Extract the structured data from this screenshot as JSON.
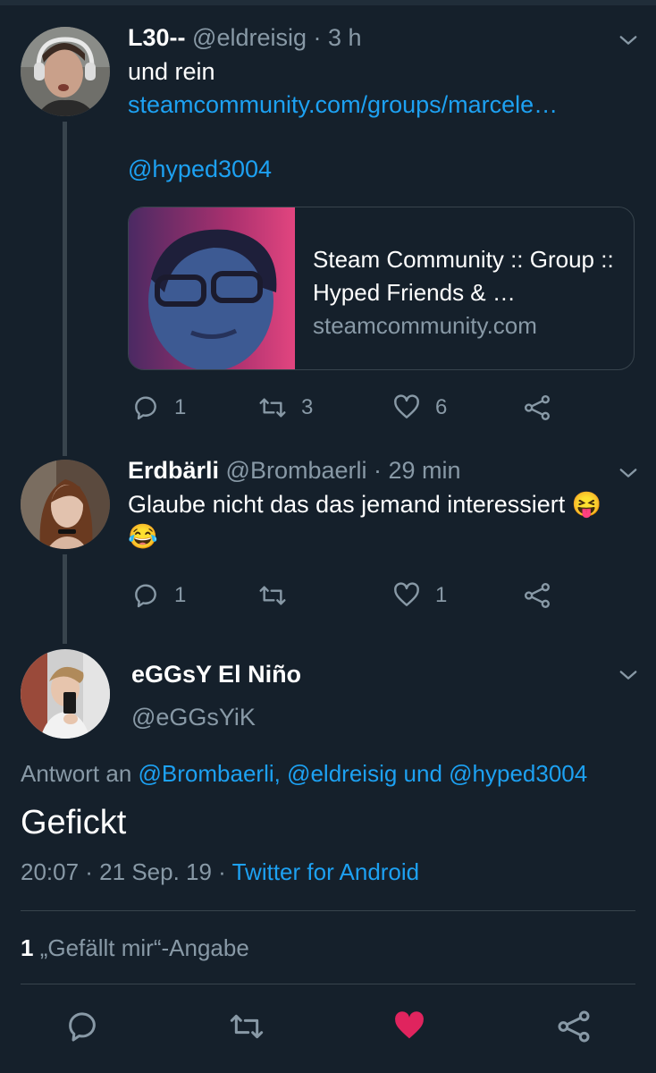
{
  "tweets": [
    {
      "name": "L30--",
      "handle": "@eldreisig",
      "time": "· 3 h",
      "text_line1": "und rein",
      "link": "steamcommunity.com/groups/marcele…",
      "mention": "@hyped3004",
      "card": {
        "title": "Steam Community :: Group :: Hyped Friends & …",
        "domain": "steamcommunity.com"
      },
      "replies": "1",
      "retweets": "3",
      "likes": "6"
    },
    {
      "name": "Erdbärli",
      "handle": "@Brombaerli",
      "time": "· 29 min",
      "text": "Glaube nicht das das jemand interessiert",
      "emoji_1": "😝",
      "emoji_2": "😂",
      "replies": "1",
      "retweets": "",
      "likes": "1"
    }
  ],
  "focused": {
    "name": "eGGsY El Niño",
    "handle": "@eGGsYiK",
    "reply_prefix": "Antwort an",
    "reply_to": "@Brombaerli, @eldreisig und @hyped3004",
    "text": "Gefickt",
    "timestamp": "20:07 · 21 Sep. 19 ·",
    "client": "Twitter for Android",
    "like_count": "1",
    "like_label": "„Gefällt mir“-Angabe"
  },
  "colors": {
    "background": "#15202b",
    "link": "#1da1f2",
    "muted": "#8899a6",
    "like_active": "#e0245e"
  },
  "icons": [
    "reply-icon",
    "retweet-icon",
    "like-icon",
    "share-icon",
    "chevron-down-icon"
  ]
}
